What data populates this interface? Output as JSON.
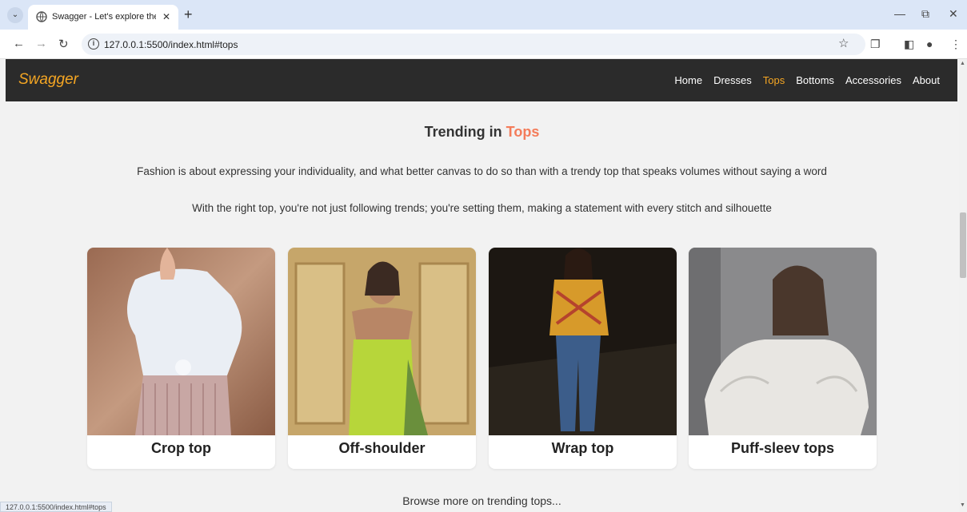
{
  "browser": {
    "tab_title": "Swagger - Let's explore the tre",
    "url": "127.0.0.1:5500/index.html#tops",
    "status_url": "127.0.0.1:5500/index.html#tops",
    "icons": {
      "tab_menu": "chevron-down-icon",
      "tab_close": "close-icon",
      "new_tab": "plus-icon",
      "back": "arrow-left-icon",
      "forward": "arrow-right-icon",
      "reload": "reload-icon",
      "info": "info-icon",
      "bookmark": "star-icon",
      "extensions": "puzzle-icon",
      "sidepanel": "sidepanel-icon",
      "profile": "avatar",
      "menu": "kebab-menu-icon",
      "minimize": "minimize-icon",
      "restore": "restore-icon",
      "close_window": "close-icon"
    }
  },
  "site": {
    "brand": "Swagger",
    "nav": [
      {
        "label": "Home",
        "active": false
      },
      {
        "label": "Dresses",
        "active": false
      },
      {
        "label": "Tops",
        "active": true
      },
      {
        "label": "Bottoms",
        "active": false
      },
      {
        "label": "Accessories",
        "active": false
      },
      {
        "label": "About",
        "active": false
      }
    ],
    "colors": {
      "navbar_bg": "#2b2b2b",
      "brand": "#f5a623",
      "accent": "#f47c5a",
      "page_bg": "#f2f2f2"
    }
  },
  "section": {
    "heading_prefix": "Trending in",
    "heading_accent": "Tops",
    "paragraphs": [
      "Fashion is about expressing your individuality, and what better canvas to do so than with a trendy top that speaks volumes without saying a word",
      "With the right top, you're not just following trends; you're setting them, making a statement with every stitch and silhouette"
    ],
    "cards": [
      {
        "label": "Crop top"
      },
      {
        "label": "Off-shoulder"
      },
      {
        "label": "Wrap top"
      },
      {
        "label": "Puff-sleev tops"
      }
    ],
    "browse_more": "Browse more on trending tops..."
  }
}
